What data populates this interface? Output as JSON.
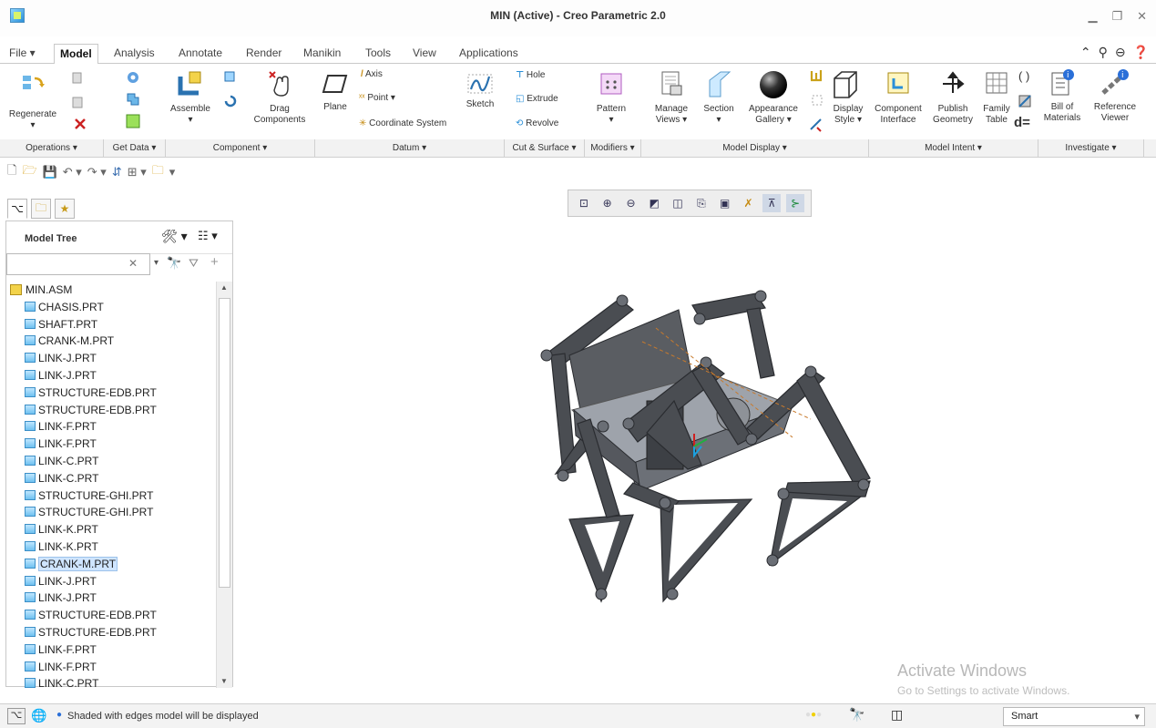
{
  "window": {
    "title": "MIN (Active) - Creo Parametric 2.0"
  },
  "tabs": [
    "File",
    "Model",
    "Analysis",
    "Annotate",
    "Render",
    "Manikin",
    "Tools",
    "View",
    "Applications"
  ],
  "active_tab": "Model",
  "ribbon": {
    "regenerate": "Regenerate",
    "assemble": "Assemble",
    "drag_components": [
      "Drag",
      "Components"
    ],
    "plane": "Plane",
    "axis": "Axis",
    "point": "Point",
    "coordinate_system": "Coordinate System",
    "sketch": "Sketch",
    "hole": "Hole",
    "extrude": "Extrude",
    "revolve": "Revolve",
    "pattern": "Pattern",
    "manage_views": [
      "Manage",
      "Views"
    ],
    "section": "Section",
    "appearance_gallery": [
      "Appearance",
      "Gallery"
    ],
    "display_style": [
      "Display",
      "Style"
    ],
    "component_interface": [
      "Component",
      "Interface"
    ],
    "publish_geometry": [
      "Publish",
      "Geometry"
    ],
    "family_table": [
      "Family",
      "Table"
    ],
    "bill_of_materials": [
      "Bill of",
      "Materials"
    ],
    "reference_viewer": [
      "Reference",
      "Viewer"
    ],
    "d_equals": "d="
  },
  "groups": [
    "Operations",
    "Get Data",
    "Component",
    "Datum",
    "Cut & Surface",
    "Modifiers",
    "Model Display",
    "Model Intent",
    "Investigate"
  ],
  "model_tree": {
    "title": "Model Tree",
    "search_value": "",
    "root": "MIN.ASM",
    "items": [
      "CHASIS.PRT",
      "SHAFT.PRT",
      "CRANK-M.PRT",
      "LINK-J.PRT",
      "LINK-J.PRT",
      "STRUCTURE-EDB.PRT",
      "STRUCTURE-EDB.PRT",
      "LINK-F.PRT",
      "LINK-F.PRT",
      "LINK-C.PRT",
      "LINK-C.PRT",
      "STRUCTURE-GHI.PRT",
      "STRUCTURE-GHI.PRT",
      "LINK-K.PRT",
      "LINK-K.PRT",
      "CRANK-M.PRT",
      "LINK-J.PRT",
      "LINK-J.PRT",
      "STRUCTURE-EDB.PRT",
      "STRUCTURE-EDB.PRT",
      "LINK-F.PRT",
      "LINK-F.PRT",
      "LINK-C.PRT"
    ],
    "selected_index": 15
  },
  "status": {
    "message": "Shaded with edges model will be displayed",
    "filter": "Smart"
  },
  "watermark": {
    "line1": "Activate Windows",
    "line2": "Go to Settings to activate Windows."
  },
  "colors": {
    "model": "#4a4d52",
    "accent": "#2a8fd8",
    "selection": "#cfe5ff"
  }
}
